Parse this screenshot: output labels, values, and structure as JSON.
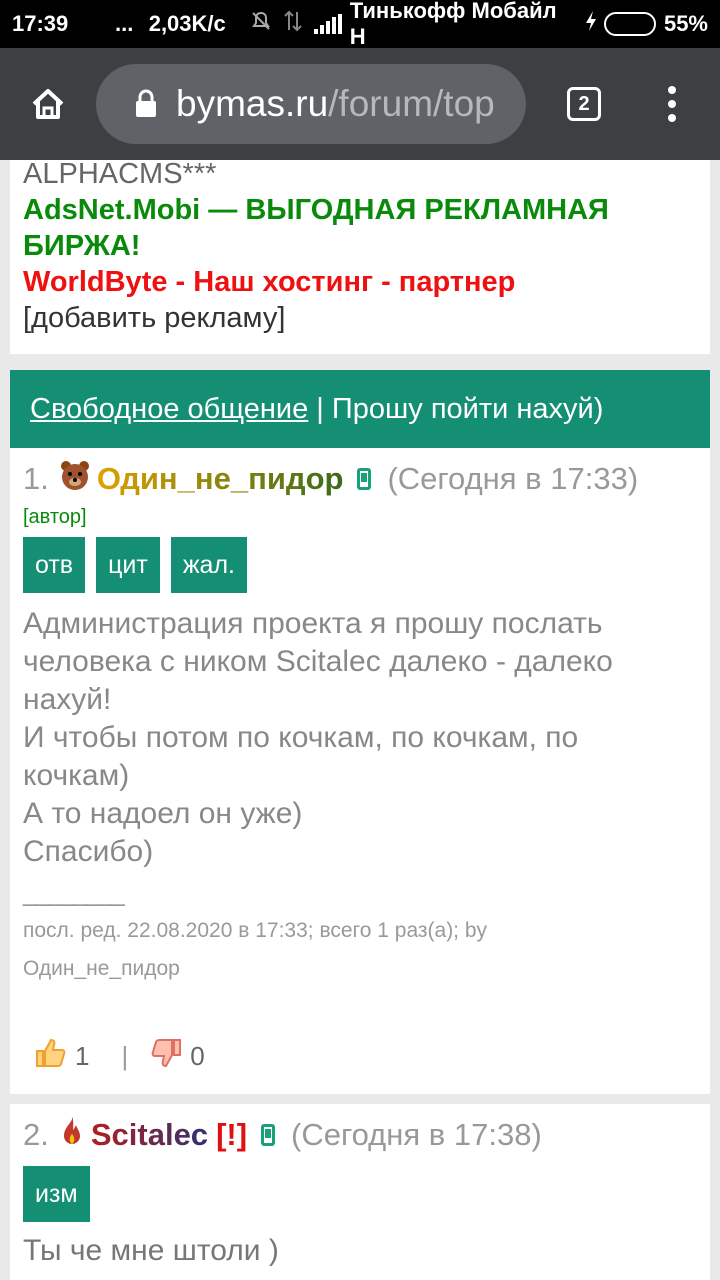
{
  "status_bar": {
    "time": "17:39",
    "dots": "...",
    "speed": "2,03K/c",
    "carrier": "Тинькофф Мобайл Н",
    "battery_pct": "55%",
    "battery_level": 0.55
  },
  "browser": {
    "url_domain": "bymas.ru",
    "url_path": "/forum/top",
    "tabs_count": "2"
  },
  "ads": {
    "line1": "ALPHACMS***",
    "line2": "AdsNet.Mobi — ВЫГОДНАЯ РЕКЛАМНАЯ",
    "line3": "БИРЖА!",
    "line4": "WorldByte - Наш хостинг - партнер",
    "line5": "[добавить рекламу]"
  },
  "topic": {
    "section_link": "Свободное общение",
    "separator": " | ",
    "title": "Прошу пойти нахуй)"
  },
  "posts": [
    {
      "num": "1.",
      "nick": "Один_не_пидор",
      "time": "(Сегодня в 17:33)",
      "author_tag": "[автор]",
      "buttons": [
        "отв",
        "цит",
        "жал."
      ],
      "text": [
        "Администрация проекта я прошу послать",
        "человека с ником Scitalec далеко - далеко",
        "нахуй!",
        "И чтобы потом по кочкам, по кочкам, по",
        "кочкам)",
        "А то надоел он уже)",
        "Спасибо)"
      ],
      "separator_line": "________",
      "edit_line1": "посл. ред. 22.08.2020 в 17:33; всего 1 раз(а); by",
      "edit_line2": "Один_не_пидор",
      "likes": "1",
      "vote_sep": "|",
      "dislikes": "0"
    },
    {
      "num": "2.",
      "nick": "Scitalec",
      "mark": "[!]",
      "time": "(Сегодня в 17:38)",
      "buttons": [
        "изм"
      ],
      "text": [
        "Ты че мне штоли )"
      ]
    }
  ],
  "colors": {
    "accent": "#148f74",
    "ad_green": "#0a8a0a",
    "ad_red": "#ee1111",
    "toolbar": "#3c4043"
  },
  "icons": [
    "home-icon",
    "lock-icon",
    "tabs-icon",
    "menu-icon",
    "bear-avatar-icon",
    "phone-icon",
    "flame-avatar-icon",
    "thumbs-up-icon",
    "thumbs-down-icon"
  ]
}
